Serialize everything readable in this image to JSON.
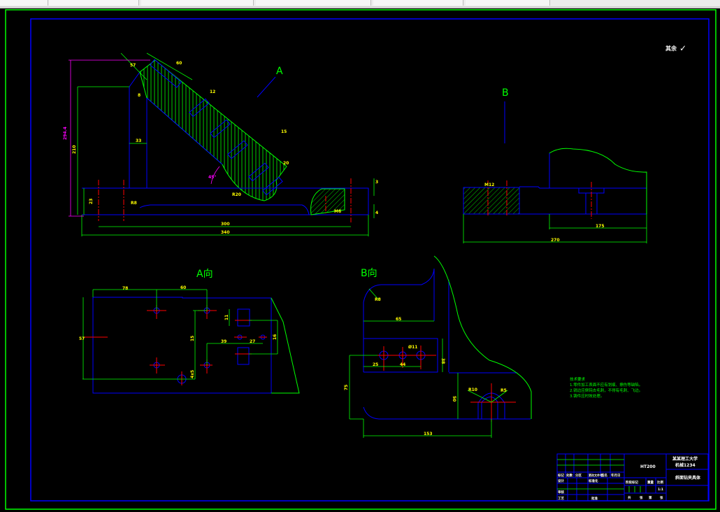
{
  "toolbar": {
    "cells": [
      "",
      "",
      "",
      "",
      "",
      ""
    ]
  },
  "colors": {
    "background": "#000000",
    "outline": "#0000ff",
    "dimension": "#00ff00",
    "dim_text": "#ffff00",
    "center": "#ff0000",
    "angle": "#ff00ff",
    "frame": "#00ff00"
  },
  "drawing": {
    "roughness_note": "其余",
    "roughness_symbol": "✓",
    "main_view": {
      "arrow_label": "A",
      "dims": {
        "height_total": "294.4",
        "height": "210",
        "col_width": "33",
        "base_h": "23",
        "inner": "300",
        "overall": "340",
        "thread": "M6",
        "d1": "3",
        "d2": "4",
        "angle": "45°",
        "r1": "R8",
        "r2": "R20",
        "s1": "57",
        "s2": "60",
        "s3": "8",
        "s4": "15",
        "s5": "20",
        "s6": "12"
      }
    },
    "view_b_marker": {
      "label": "B",
      "dims": {
        "thread": "M12",
        "len1": "175",
        "len2": "270"
      }
    },
    "view_a": {
      "title": "A向",
      "dims": {
        "d78": "78",
        "d60": "60",
        "d57": "57",
        "d11": "11",
        "d15": "15",
        "d39": "39",
        "d27": "27",
        "d16": "16",
        "d45": "4x5"
      }
    },
    "view_b": {
      "title": "B向",
      "dims": {
        "r8": "R8",
        "d65": "65",
        "d25": "25",
        "d44": "44",
        "d11": "Ø11",
        "d38": "38",
        "d75": "75",
        "d50": "50",
        "d153": "153",
        "r10": "R10",
        "r5": "R5"
      }
    }
  },
  "tech_requirements": {
    "title": "技术要求",
    "lines": [
      "1.零件加工表面不应有划痕、擦伤等缺陷。",
      "2.锐边应倒钝去毛刺，不得有毛刺、飞边。",
      "3.铸件应时效处理。"
    ]
  },
  "title_block": {
    "material": "HT200",
    "school": "某某理工大学",
    "class": "机械1234",
    "part_name": "斜面钻夹具体",
    "row_labels": [
      "标记",
      "处数",
      "分区",
      "更改文件号",
      "签名",
      "年月日"
    ],
    "design": "设计",
    "std": "标准化",
    "review": "审核",
    "process": "工艺",
    "approve": "批准",
    "stage": "阶段标记",
    "weight": "重量",
    "scale": "比例",
    "scale_val": "1:1",
    "sheets": "共",
    "sheet_of": "张",
    "sheet_no": "第",
    "sheet_no2": "张"
  }
}
